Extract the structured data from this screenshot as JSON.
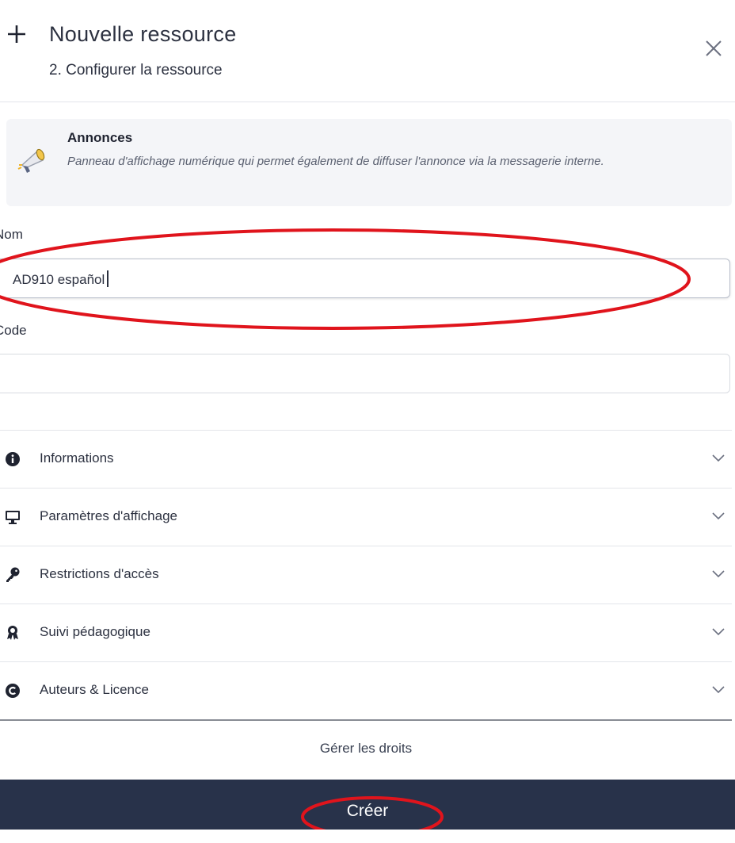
{
  "header": {
    "title": "Nouvelle ressource",
    "subtitle": "2. Configurer la ressource"
  },
  "resource_type": {
    "name": "Annonces",
    "description": "Panneau d'affichage numérique qui permet également de diffuser l'annonce via la messagerie interne."
  },
  "form": {
    "name_label": "Nom",
    "name_value": "AD910 español",
    "code_label": "Code",
    "code_value": ""
  },
  "sections": [
    {
      "label": "Informations",
      "icon": "info-circle-icon"
    },
    {
      "label": "Paramètres d'affichage",
      "icon": "monitor-icon"
    },
    {
      "label": "Restrictions d'accès",
      "icon": "key-icon"
    },
    {
      "label": "Suivi pédagogique",
      "icon": "award-icon"
    },
    {
      "label": "Auteurs & Licence",
      "icon": "copyright-icon"
    }
  ],
  "footer": {
    "rights_label": "Gérer les droits",
    "create_label": "Créer"
  },
  "colors": {
    "primary_button": "#28324a",
    "highlight_annotation": "#e0141c"
  }
}
